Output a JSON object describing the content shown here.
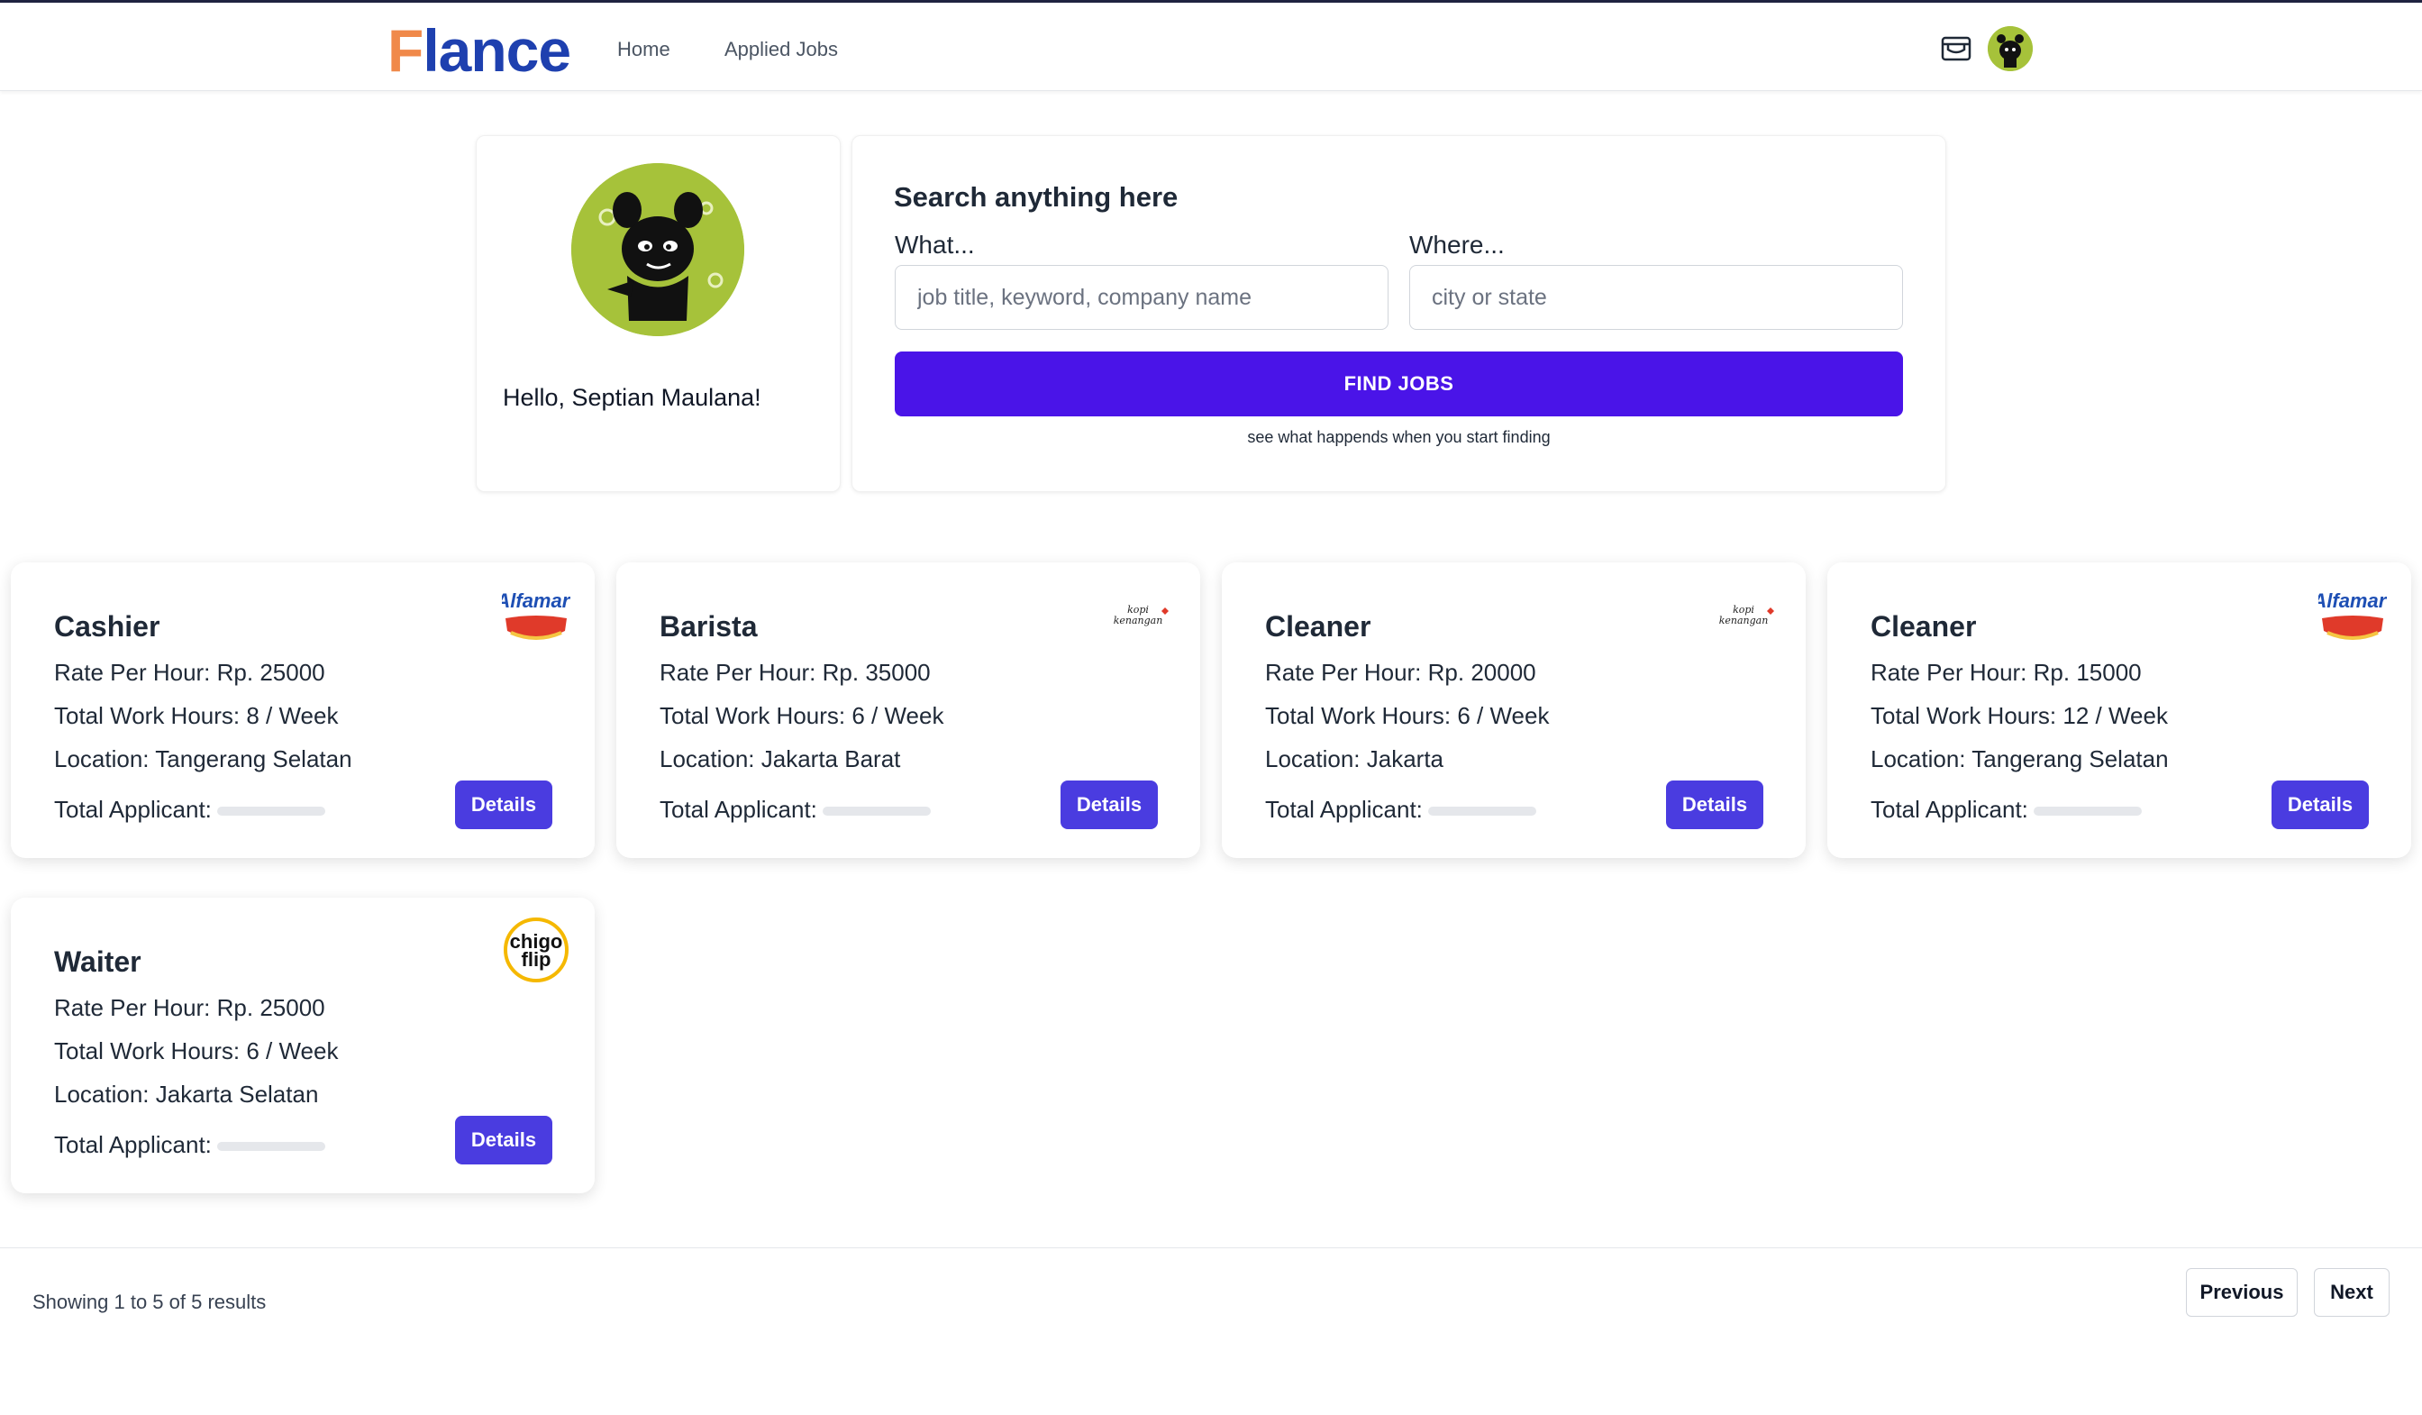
{
  "nav": {
    "brand_first": "F",
    "brand_rest": "lance",
    "links": [
      {
        "label": "Home"
      },
      {
        "label": "Applied Jobs"
      }
    ],
    "inbox_icon": "inbox-icon",
    "avatar": "user-avatar"
  },
  "profile": {
    "greeting": "Hello, Septian Maulana!"
  },
  "search": {
    "title": "Search anything here",
    "what_label": "What...",
    "what_placeholder": "job title, keyword, company name",
    "where_label": "Where...",
    "where_placeholder": "city or state",
    "button_label": "FIND JOBS",
    "hint": "see what happends when you start finding"
  },
  "jobs": [
    {
      "title": "Cashier",
      "rate": "Rate Per Hour: Rp. 25000",
      "hours": "Total Work Hours: 8 / Week",
      "location": "Location: Tangerang Selatan",
      "applicant_label": "Total Applicant:",
      "details_label": "Details",
      "logo": "alfamart-logo"
    },
    {
      "title": "Barista",
      "rate": "Rate Per Hour: Rp. 35000",
      "hours": "Total Work Hours: 6 / Week",
      "location": "Location: Jakarta Barat",
      "applicant_label": "Total Applicant:",
      "details_label": "Details",
      "logo": "kopi-kenangan-logo"
    },
    {
      "title": "Cleaner",
      "rate": "Rate Per Hour: Rp. 20000",
      "hours": "Total Work Hours: 6 / Week",
      "location": "Location: Jakarta",
      "applicant_label": "Total Applicant:",
      "details_label": "Details",
      "logo": "kopi-kenangan-logo"
    },
    {
      "title": "Cleaner",
      "rate": "Rate Per Hour: Rp. 15000",
      "hours": "Total Work Hours: 12 / Week",
      "location": "Location: Tangerang Selatan",
      "applicant_label": "Total Applicant:",
      "details_label": "Details",
      "logo": "alfamart-logo"
    },
    {
      "title": "Waiter",
      "rate": "Rate Per Hour: Rp. 25000",
      "hours": "Total Work Hours: 6 / Week",
      "location": "Location: Jakarta Selatan",
      "applicant_label": "Total Applicant:",
      "details_label": "Details",
      "logo": "chigo-flip-logo"
    }
  ],
  "pagination": {
    "showing": "Showing 1 to 5 of 5 results",
    "previous_label": "Previous",
    "next_label": "Next"
  },
  "colors": {
    "brand_blue": "#1e40af",
    "brand_orange": "#f0894a",
    "primary_button": "#4a14e8",
    "details_button": "#4a3ce0"
  }
}
